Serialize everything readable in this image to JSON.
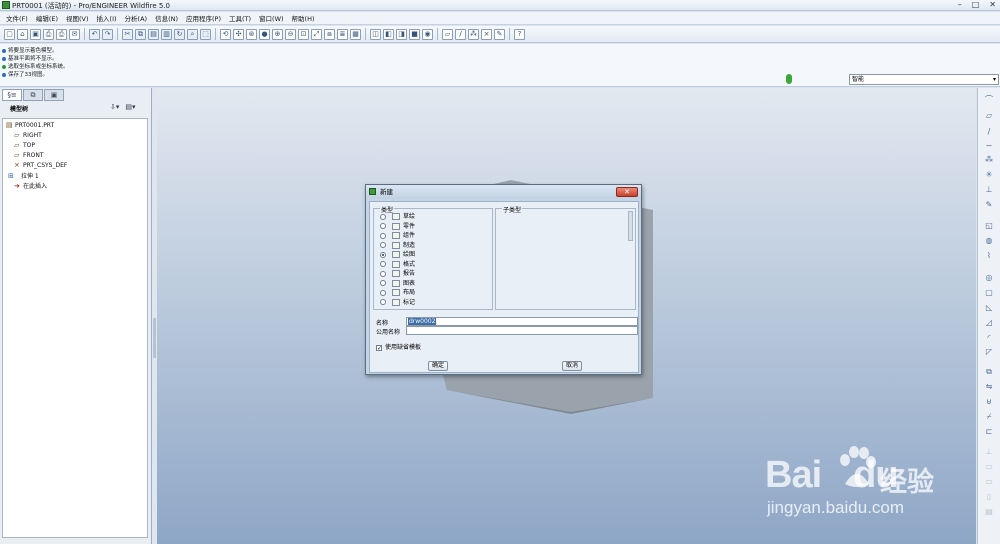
{
  "window": {
    "title": "PRT0001 (活动的) - Pro/ENGINEER Wildfire 5.0",
    "min": "–",
    "max": "□",
    "close": "✕"
  },
  "menu": [
    "文件(F)",
    "编辑(E)",
    "视图(V)",
    "插入(I)",
    "分析(A)",
    "信息(N)",
    "应用程序(P)",
    "工具(T)",
    "窗口(W)",
    "帮助(H)"
  ],
  "messages": [
    "将要显示着色模型。",
    "基准平面将不显示。",
    "选取坐标系或坐标系统。",
    "保存了33视图。"
  ],
  "smart_filter": {
    "value": "智能",
    "arrow": "▾"
  },
  "panel": {
    "tree_header": "模型树",
    "tab1": "§≡",
    "tab2": "⧉",
    "tab3": "▣",
    "tool1": "⇩▾",
    "tool2": "▤▾",
    "items": [
      {
        "icon": "▤",
        "label": "PRT0001.PRT"
      },
      {
        "icon": "▱",
        "label": "RIGHT"
      },
      {
        "icon": "▱",
        "label": "TOP"
      },
      {
        "icon": "▱",
        "label": "FRONT"
      },
      {
        "icon": "⨯",
        "label": "PRT_CSYS_DEF"
      },
      {
        "icon": "⊞",
        "label": "拉伸 1"
      },
      {
        "icon": "➔",
        "label": "在此插入"
      }
    ]
  },
  "dialog": {
    "title": "新建",
    "close": "✕",
    "type_group": "类型",
    "subtype_group": "子类型",
    "types": [
      {
        "label": "草绘",
        "selected": false
      },
      {
        "label": "零件",
        "selected": false
      },
      {
        "label": "组件",
        "selected": false
      },
      {
        "label": "制造",
        "selected": false
      },
      {
        "label": "绘图",
        "selected": true
      },
      {
        "label": "格式",
        "selected": false
      },
      {
        "label": "报告",
        "selected": false
      },
      {
        "label": "图表",
        "selected": false
      },
      {
        "label": "布局",
        "selected": false
      },
      {
        "label": "标记",
        "selected": false
      }
    ],
    "name_label": "名称",
    "name_value": "drw0002",
    "common_name_label": "公用名称",
    "common_name_value": "",
    "use_default_template": "使用缺省模板",
    "use_default_checked": true,
    "ok": "确定",
    "cancel": "取消"
  },
  "watermark": {
    "brand": "Bai",
    "brand2": "du",
    "cn": "经验",
    "url": "jingyan.baidu.com"
  },
  "colors": {
    "viewport_top": "#e2e8f0",
    "viewport_bottom": "#8ea6c6",
    "dialog_close": "#c8412c",
    "accent_green": "#3aa83a"
  }
}
